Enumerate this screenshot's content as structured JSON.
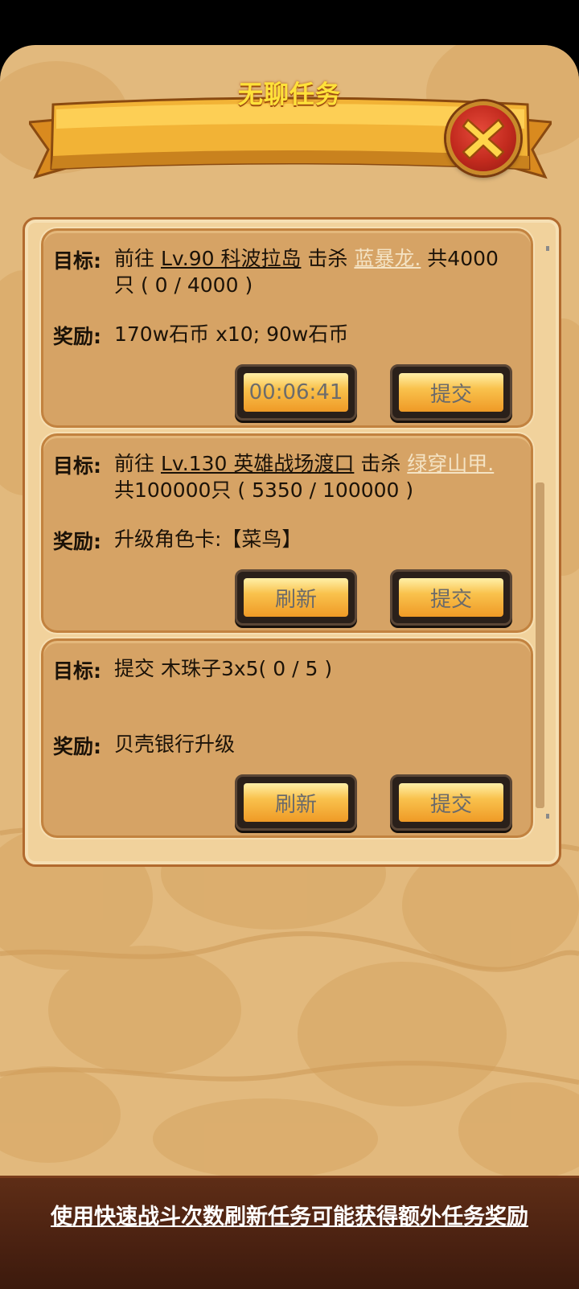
{
  "header": {
    "title": "无聊任务"
  },
  "labels": {
    "goal": "目标:",
    "reward": "奖励:"
  },
  "tasks": [
    {
      "goal_prefix": "前往",
      "location": "Lv.90 科波拉岛",
      "kill_word": "击杀",
      "target": "蓝暴龙.",
      "goal_tail": "共4000",
      "goal_line2": "只 ( 0 / 4000 )",
      "reward": "170w石币 x10; 90w石币",
      "left_button": "00:06:41",
      "right_button": "提交"
    },
    {
      "goal_prefix": "前往",
      "location": "Lv.130 英雄战场渡口",
      "kill_word": "击杀",
      "target": "绿穿山甲.",
      "goal_line2": "共100000只 ( 5350 / 100000 )",
      "reward": "升级角色卡:【菜鸟】",
      "left_button": "刷新",
      "right_button": "提交"
    },
    {
      "goal_line1": "提交 木珠子3x5( 0 / 5 )",
      "reward": "贝壳银行升级",
      "left_button": "刷新",
      "right_button": "提交"
    }
  ],
  "footer": {
    "hint": "使用快速战斗次数刷新任务可能获得额外任务奖励"
  },
  "colors": {
    "panel": "#e2b97d",
    "card": "#d6a365",
    "title_text": "#ffe23a",
    "button_gradient_top": "#fff0a8",
    "button_gradient_bottom": "#ef9a26",
    "footer": "#4a2111",
    "close_button": "#c22a1e"
  },
  "icons": {
    "close": "close-x-icon",
    "ribbon": "title-ribbon-banner"
  }
}
